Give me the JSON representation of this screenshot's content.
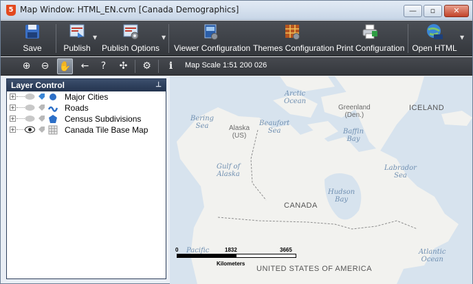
{
  "window": {
    "title": "Map Window: HTML_EN.cvm [Canada Demographics]",
    "app_icon_glyph": "5",
    "minimize_glyph": "—",
    "maximize_glyph": "▫",
    "close_glyph": "✕"
  },
  "toolbar": {
    "buttons": [
      {
        "label": "Save",
        "icon": "floppy-disk-icon"
      },
      {
        "label": "Publish",
        "icon": "publish-icon",
        "has_dropdown": true
      },
      {
        "label": "Publish Options",
        "icon": "publish-options-icon",
        "has_dropdown": true
      },
      {
        "label": "Viewer Configuration",
        "icon": "viewer-configuration-icon"
      },
      {
        "label": "Themes Configuration",
        "icon": "themes-configuration-icon"
      },
      {
        "label": "Print Configuration",
        "icon": "printer-icon"
      },
      {
        "label": "Open HTML",
        "icon": "open-html-icon",
        "has_dropdown": true
      }
    ],
    "dropdown_glyph": "▼"
  },
  "nav_toolbar": {
    "tools": [
      {
        "name": "zoom-in",
        "glyph": "⊕"
      },
      {
        "name": "zoom-out",
        "glyph": "⊖"
      },
      {
        "name": "pan",
        "glyph": "✋",
        "active": true
      },
      {
        "name": "back",
        "glyph": "←"
      },
      {
        "name": "zoom-extent",
        "glyph": "?"
      },
      {
        "name": "full-extent",
        "glyph": "✣"
      },
      {
        "name": "settings",
        "glyph": "⚙"
      },
      {
        "name": "info",
        "glyph": "i"
      }
    ],
    "map_scale": "Map Scale 1:51 200 026"
  },
  "layer_control": {
    "title": "Layer Control",
    "pin_glyph": "⊥",
    "layers": [
      {
        "label": "Major Cities",
        "icon": "point-layer-icon",
        "visible": false
      },
      {
        "label": "Roads",
        "icon": "line-layer-icon",
        "visible": false
      },
      {
        "label": "Census Subdivisions",
        "icon": "polygon-layer-icon",
        "visible": false
      },
      {
        "label": "Canada Tile Base Map",
        "icon": "tile-layer-icon",
        "visible": true
      }
    ],
    "expander_glyph": "+"
  },
  "map": {
    "water_labels": [
      {
        "text": "Arctic\nOcean"
      },
      {
        "text": "Bering\nSea"
      },
      {
        "text": "Beaufort\nSea"
      },
      {
        "text": "Baffin\nBay"
      },
      {
        "text": "Gulf of\nAlaska"
      },
      {
        "text": "Labrador\nSea"
      },
      {
        "text": "Hudson\nBay"
      },
      {
        "text": "Pacific"
      },
      {
        "text": "Atlantic\nOcean"
      }
    ],
    "land_labels": [
      {
        "text": "Alaska\n(US)"
      },
      {
        "text": "Greenland\n(Den.)"
      }
    ],
    "country_labels": [
      {
        "text": "ICELAND"
      },
      {
        "text": "CANADA"
      },
      {
        "text": "UNITED STATES OF AMERICA"
      }
    ],
    "scalebar": {
      "ticks": [
        "0",
        "1832",
        "3665"
      ],
      "unit": "Kilometers"
    },
    "colors": {
      "water": "#d7e3ee",
      "land": "#f2f2ef",
      "border": "#8c8c8c"
    }
  }
}
